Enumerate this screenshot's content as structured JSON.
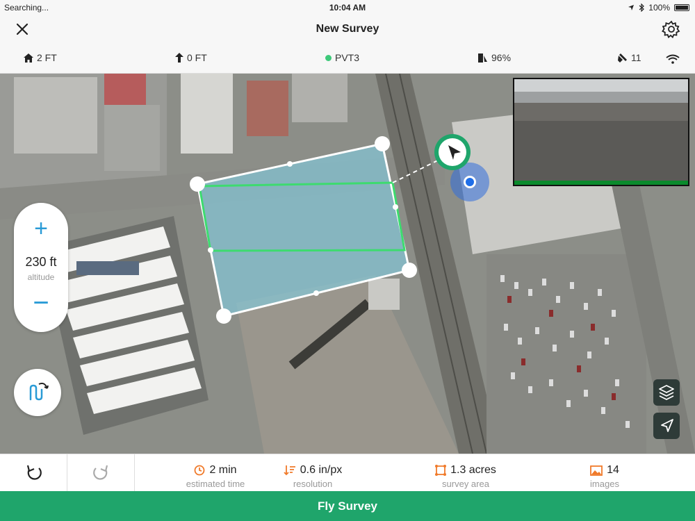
{
  "status_bar": {
    "carrier": "Searching...",
    "time": "10:04 AM",
    "battery": "100%"
  },
  "nav": {
    "title": "New Survey"
  },
  "telemetry": {
    "home_altitude": "2 FT",
    "vertical": "0 FT",
    "gps_mode": "PVT3",
    "battery": "96%",
    "satellites": "11"
  },
  "map": {
    "altitude_value": "230 ft",
    "altitude_label": "altitude",
    "plus": "+",
    "minus": "−"
  },
  "stats": {
    "time_value": "2 min",
    "time_label": "estimated time",
    "resolution_value": "0.6 in/px",
    "resolution_label": "resolution",
    "area_value": "1.3 acres",
    "area_label": "survey area",
    "images_value": "14",
    "images_label": "images"
  },
  "fly_button": "Fly Survey",
  "colors": {
    "accent_green": "#1fa56b",
    "gps_green": "#3ec97a",
    "icon_blue": "#2a9bd6",
    "stat_orange": "#f07a2a"
  },
  "icons": [
    "close-icon",
    "gear-icon",
    "home-icon",
    "arrow-up-icon",
    "gps-dot-icon",
    "drone-battery-icon",
    "satellite-icon",
    "wifi-icon",
    "layers-icon",
    "locate-icon",
    "flight-pattern-icon",
    "undo-icon",
    "redo-icon",
    "clock-icon",
    "resolution-icon",
    "area-icon",
    "image-icon"
  ]
}
